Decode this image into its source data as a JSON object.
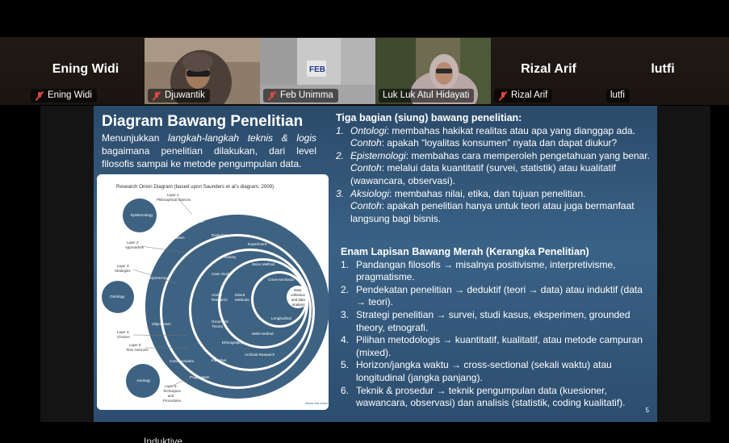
{
  "participants": [
    {
      "name": "Ening Widi",
      "label": "Ening Widi",
      "muted": true,
      "video": false
    },
    {
      "name": "Djuwantik",
      "label": "Djuwantik",
      "muted": true,
      "video": true
    },
    {
      "name": "Feb Unimma",
      "label": "Feb Unimma",
      "muted": true,
      "video": true
    },
    {
      "name": "Luk Luk Atul Hidayati",
      "label": "Luk Luk Atul Hidayati",
      "muted": false,
      "video": true,
      "active": true
    },
    {
      "name": "Rizal Arif",
      "label": "Rizal Arif",
      "muted": true,
      "video": false
    },
    {
      "name": "lutfi",
      "label": "lutfi",
      "muted": false,
      "video": false
    }
  ],
  "colors": {
    "active_border": "#23d96b",
    "slide_bg": "#335a7e",
    "muted_icon": "#e0483e"
  },
  "slide": {
    "title": "Diagram Bawang Penelitian",
    "intro_1": "Menunjukkan ",
    "intro_em": "langkah-langkah teknis & logis",
    "intro_2": " bagaimana penelitian dilakukan, dari level filosofis sampai ke metode pengumpulan data.",
    "diagram": {
      "title": "Research Onion Diagram (based upon Saunders et al's diagram, 2009)",
      "layer1": "Layer 1:",
      "layer1b": "Philosophical Stances",
      "layer2": "Layer 2:",
      "layer2b": "Approaches",
      "layer3": "Layer 3:",
      "layer3b": "Strategies",
      "layer4": "Layer 4:",
      "layer4b": "Choices",
      "layer5": "Layer 5:",
      "layer5b": "Time Horizons",
      "layer6": "Layer 6:",
      "layer6b": "Techniques",
      "layer6c": "and",
      "layer6d": "Procedures",
      "epistemology": "Epistemology",
      "ontology": "Ontology",
      "axiology": "Axiology",
      "positivism": "Positivism",
      "realism": "Realism",
      "interpretivism": "Interpretivism",
      "objectivism": "Objectivism",
      "constructivism": "Constructivism",
      "pragmatism": "Pragmatism",
      "deductive": "Deductive",
      "inductive": "Inductive",
      "experiment": "Experiment",
      "survey": "Survey",
      "case_study": "Case Study",
      "action_research": "Action",
      "action_research_b": "Research",
      "grounded_theory": "Grounded",
      "grounded_theory_b": "Theory",
      "ethnography": "Ethnography",
      "archival_research": "Archival Research",
      "mono_method": "Mono Method",
      "mixed_methods": "Mixed",
      "mixed_methods_b": "Methods",
      "multi_method": "Multi-method",
      "cross_sectional": "Cross-sectional",
      "longitudinal": "Longitudinal",
      "data_1": "Data",
      "data_2": "collection",
      "data_3": "and data",
      "data_4": "analysis",
      "footer": "About the onion"
    },
    "section1": {
      "title": "Tiga bagian (siung) bawang penelitian:",
      "items": [
        {
          "num": "1.",
          "term": "Ontologi",
          "text": ": membahas hakikat realitas atau apa yang dianggap ada.",
          "ex_label": "Contoh",
          "ex_text": ": apakah “loyalitas konsumen” nyata dan dapat diukur?"
        },
        {
          "num": "2.",
          "term": "Epistemologi",
          "text": ": membahas cara memperoleh pengetahuan yang benar.",
          "ex_label": "Contoh",
          "ex_text": ": melalui data kuantitatif (survei, statistik) atau kualitatif (wawancara, observasi)."
        },
        {
          "num": "3.",
          "term": "Aksiologi",
          "text": ": membahas nilai, etika, dan tujuan penelitian.",
          "ex_label": "Contoh",
          "ex_text": ": apakah penelitian hanya untuk teori atau juga bermanfaat langsung bagi bisnis."
        }
      ]
    },
    "section2": {
      "title": "Enam Lapisan Bawang Merah (Kerangka Penelitian)",
      "items": [
        {
          "num": "1.",
          "text": "Pandangan filosofis → misalnya positivisme, interpretivisme, pragmatisme."
        },
        {
          "num": "2.",
          "text": "Pendekatan penelitian → deduktif (teori → data) atau induktif (data → teori)."
        },
        {
          "num": "3.",
          "text": "Strategi penelitian → survei, studi kasus, eksperimen, grounded theory, etnografi."
        },
        {
          "num": "4.",
          "text": "Pilihan metodologis → kuantitatif, kualitatif, atau metode campuran (mixed)."
        },
        {
          "num": "5.",
          "text": "Horizon/jangka waktu → cross-sectional (sekali waktu) atau longitudinal (jangka panjang)."
        },
        {
          "num": "6.",
          "text": "Teknik & prosedur → teknik pengumpulan data (kuesioner, wawancara, observasi) dan analisis (statistik, coding kualitatif)."
        }
      ]
    },
    "page_number": "5"
  },
  "bottom_text": "Induktive"
}
